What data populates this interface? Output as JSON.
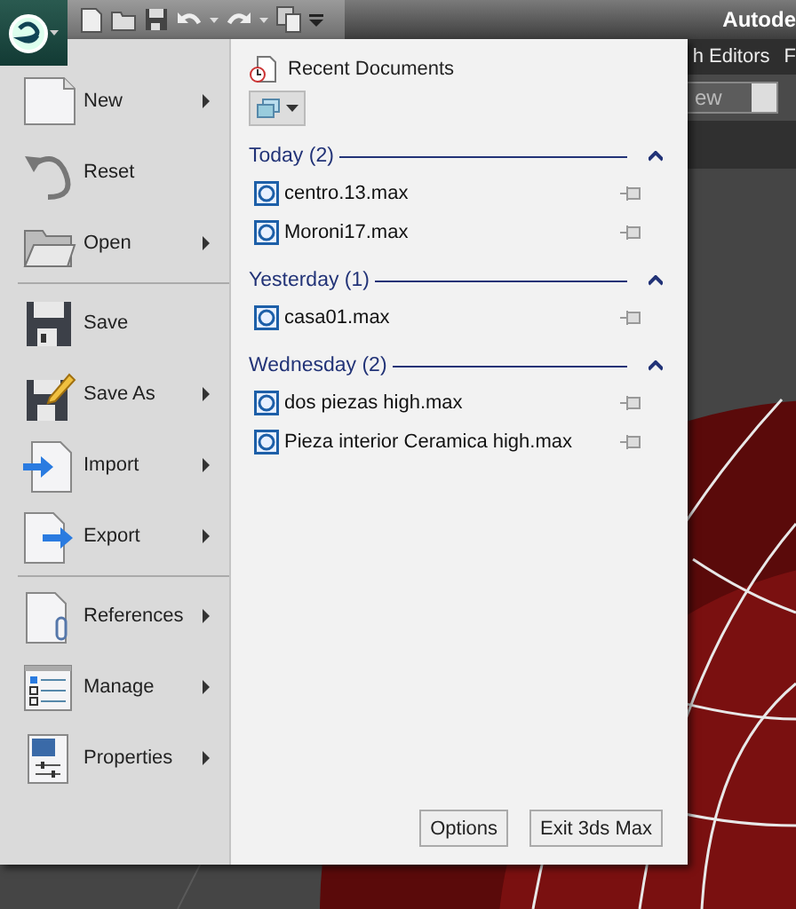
{
  "title_bar": {
    "title": "Autode"
  },
  "menu_bar": {
    "items": [
      "h Editors",
      "F"
    ]
  },
  "toolbar": {
    "dropdown_value": "ew"
  },
  "application_menu": {
    "command_groups": [
      [
        {
          "label": "New",
          "kind": "new",
          "submenu": true
        },
        {
          "label": "Reset",
          "kind": "reset",
          "submenu": false
        },
        {
          "label": "Open",
          "kind": "open",
          "submenu": true
        }
      ],
      [
        {
          "label": "Save",
          "kind": "save",
          "submenu": false
        },
        {
          "label": "Save As",
          "kind": "saveas",
          "submenu": true
        },
        {
          "label": "Import",
          "kind": "import",
          "submenu": true
        },
        {
          "label": "Export",
          "kind": "export",
          "submenu": true
        }
      ],
      [
        {
          "label": "References",
          "kind": "references",
          "submenu": true
        },
        {
          "label": "Manage",
          "kind": "manage",
          "submenu": true
        },
        {
          "label": "Properties",
          "kind": "properties",
          "submenu": true
        }
      ]
    ]
  },
  "recent_documents": {
    "title": "Recent Documents",
    "groups": [
      {
        "label": "Today (2)",
        "expanded": true,
        "files": [
          "centro.13.max",
          "Moroni17.max"
        ]
      },
      {
        "label": "Yesterday (1)",
        "expanded": true,
        "files": [
          "casa01.max"
        ]
      },
      {
        "label": "Wednesday (2)",
        "expanded": true,
        "files": [
          "dos piezas high.max",
          "Pieza interior Ceramica high.max"
        ]
      }
    ]
  },
  "buttons": [
    "Options",
    "Exit 3ds Max"
  ]
}
